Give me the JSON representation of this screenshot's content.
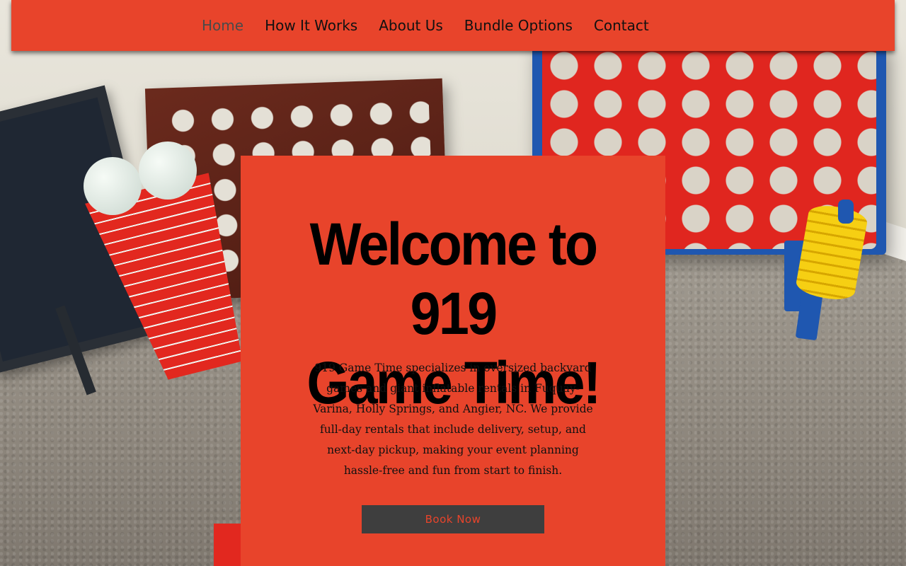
{
  "nav": {
    "items": [
      {
        "label": "Home",
        "active": true
      },
      {
        "label": "How It Works",
        "active": false
      },
      {
        "label": "About Us",
        "active": false
      },
      {
        "label": "Bundle Options",
        "active": false
      },
      {
        "label": "Contact",
        "active": false
      }
    ]
  },
  "hero": {
    "title_line1": "Welcome to 919",
    "title_line2": "Game Time!",
    "description": "919 Game Time specializes in oversized backyard games and giant inflatable rentals in Fuquay-Varina, Holly Springs, and Angier, NC. We provide full-day rentals that include delivery, setup, and next-day pickup, making your event planning hassle-free and fun from start to finish.",
    "cta_label": "Book Now"
  },
  "colors": {
    "brand_orange": "#e8442b",
    "button_bg": "#3e3e3e",
    "text_dark": "#111111",
    "nav_active": "#4a4a4a"
  }
}
